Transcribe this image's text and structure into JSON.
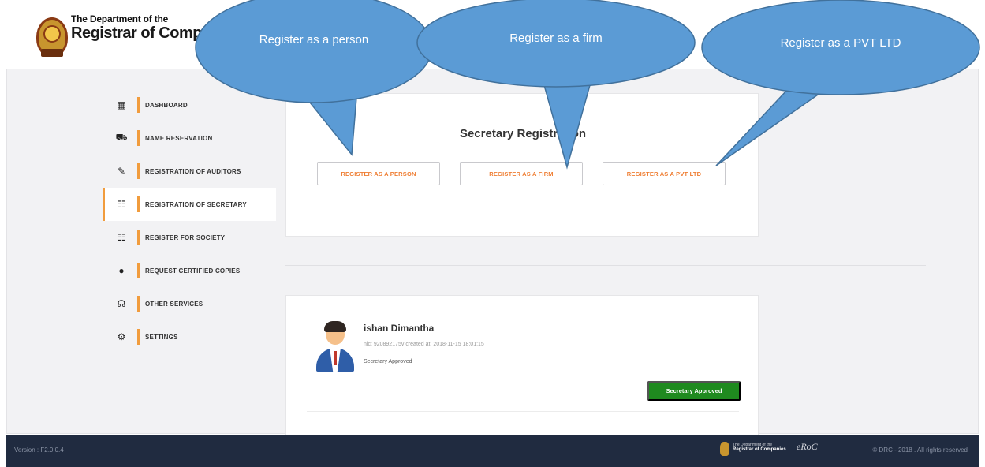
{
  "header": {
    "brand_line1": "The Department of the",
    "brand_line2": "Registrar of Comp"
  },
  "sidebar": {
    "items": [
      {
        "label": "DASHBOARD",
        "icon": "building-icon",
        "glyph": "▦"
      },
      {
        "label": "NAME RESERVATION",
        "icon": "cart-icon",
        "glyph": "⛟"
      },
      {
        "label": "REGISTRATION OF AUDITORS",
        "icon": "tools-icon",
        "glyph": "✎"
      },
      {
        "label": "REGISTRATION OF SECRETARY",
        "icon": "users-icon",
        "glyph": "☷"
      },
      {
        "label": "REGISTER FOR SOCIETY",
        "icon": "users-icon",
        "glyph": "☷"
      },
      {
        "label": "REQUEST CERTIFIED COPIES",
        "icon": "circle-icon",
        "glyph": "●"
      },
      {
        "label": "OTHER SERVICES",
        "icon": "headset-icon",
        "glyph": "☊"
      },
      {
        "label": "SETTINGS",
        "icon": "gear-icon",
        "glyph": "⚙"
      }
    ],
    "active_index": 3
  },
  "registration": {
    "title": "Secretary Registration",
    "buttons": {
      "person": "REGISTER AS A PERSON",
      "firm": "REGISTER AS A FIRM",
      "pvt": "REGISTER AS A PVT LTD"
    }
  },
  "callouts": {
    "person": "Register as a person",
    "firm": "Register as a firm",
    "pvt": "Register as a PVT LTD"
  },
  "profile": {
    "name": "ishan Dimantha",
    "meta": "nic: 920892175v   created at: 2018-11-15 18:01:15",
    "status_text": "Secretary Approved",
    "status_button": "Secretary Approved"
  },
  "footer": {
    "version": "Version : F2.0.0.4",
    "logo_line1": "The Department of the",
    "logo_line2": "Registrar of Companies",
    "logo2": "eRoC",
    "copyright": "© DRC - 2018 . All rights reserved"
  },
  "colors": {
    "accent": "#f19c3d",
    "button_text": "#ef7e33",
    "callout": "#5b9bd5",
    "approved": "#1f8a1f",
    "footer": "#202b40"
  }
}
